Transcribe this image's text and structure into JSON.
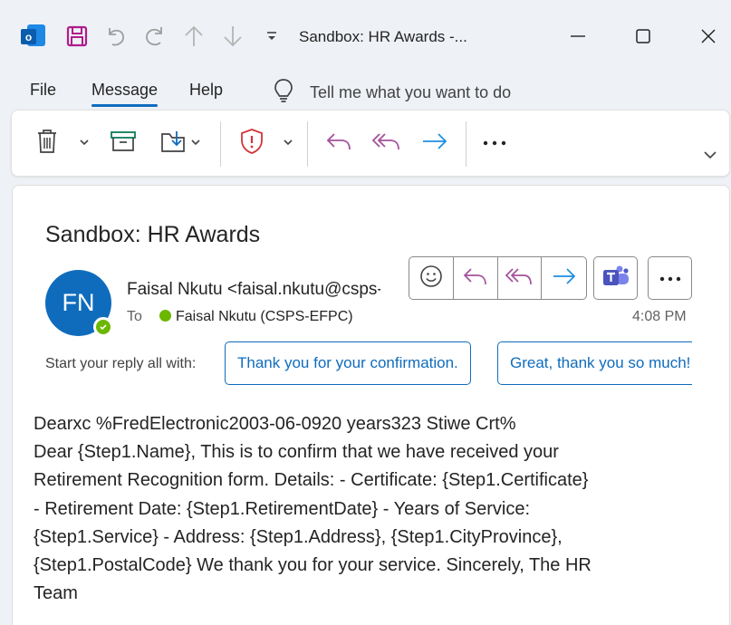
{
  "window": {
    "title": "Sandbox: HR Awards  -...",
    "app_icon_letter": "o"
  },
  "menu": {
    "file": "File",
    "message": "Message",
    "help": "Help",
    "tell_me_placeholder": "Tell me what you want to do"
  },
  "message": {
    "subject": "Sandbox: HR Awards",
    "sender_initials": "FN",
    "from": "Faisal Nkutu <faisal.nkutu@csps-efpc.gc.ca>",
    "to_label": "To",
    "to": "Faisal Nkutu  (CSPS-EFPC)",
    "time": "4:08 PM",
    "reply_prompt": "Start your reply all with:",
    "suggestions": [
      "Thank you for your confirmation.",
      "Great, thank you so much!"
    ],
    "body_lines": [
      "Dearxc %FredElectronic2003-06-0920 years323 Stiwe Crt%",
      "Dear {Step1.Name}, This is to confirm that we have received your",
      "Retirement Recognition form. Details: - Certificate: {Step1.Certificate}",
      "- Retirement Date: {Step1.RetirementDate} - Years of Service:",
      "{Step1.Service} - Address: {Step1.Address}, {Step1.CityProvince},",
      "{Step1.PostalCode} We thank you for your service. Sincerely, The HR",
      "Team"
    ]
  },
  "colors": {
    "accent": "#0f6cbd",
    "save_purple": "#b01c8c",
    "reply_purple": "#a4519b",
    "forward_blue": "#1f8fe0",
    "report_red": "#d13438",
    "presence_green": "#6bb700"
  }
}
